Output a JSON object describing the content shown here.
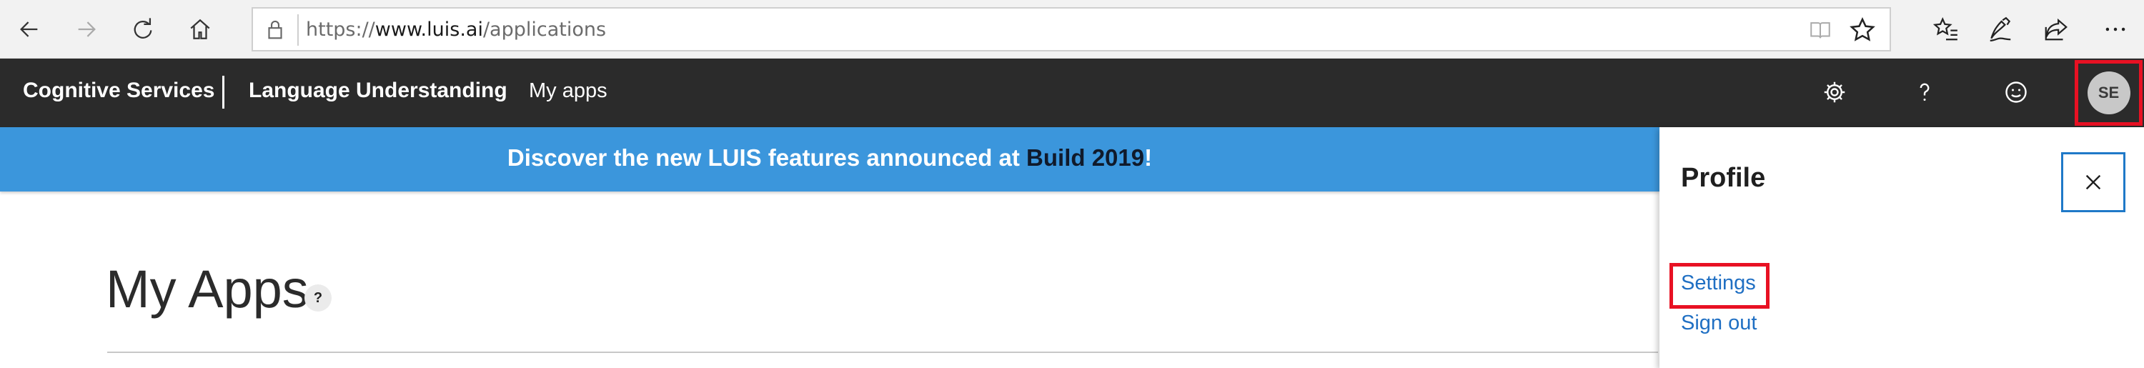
{
  "browser": {
    "url_scheme": "https://",
    "url_host": "www.luis.ai",
    "url_path": "/applications",
    "icons": [
      "back-icon",
      "forward-icon",
      "refresh-icon",
      "home-icon",
      "lock-icon",
      "reading-view-icon",
      "favorite-star-icon",
      "favorites-list-icon",
      "pen-icon",
      "share-icon",
      "more-icon"
    ]
  },
  "header": {
    "brand": "Cognitive Services",
    "product": "Language Understanding",
    "nav_my_apps": "My apps",
    "avatar_initials": "SE",
    "icons": [
      "settings-gear-icon",
      "help-icon",
      "feedback-smiley-icon"
    ]
  },
  "banner": {
    "text": "Discover the new LUIS features announced at ",
    "link": "Build 2019",
    "suffix": "!",
    "background": "#3b96dc"
  },
  "main": {
    "title": "My Apps",
    "help_badge": "?"
  },
  "profile_panel": {
    "title": "Profile",
    "settings_label": "Settings",
    "signout_label": "Sign out",
    "highlight_color": "#e81123"
  }
}
